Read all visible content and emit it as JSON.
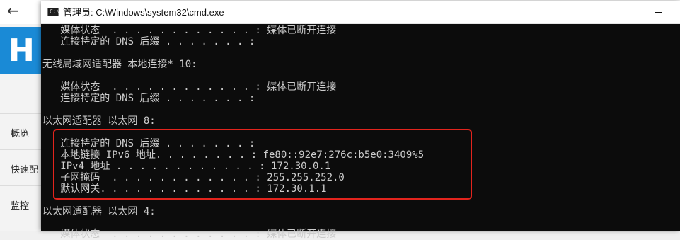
{
  "background_app": {
    "back_icon": "arrow-left-icon",
    "back_glyph": "←",
    "logo_text": "H",
    "nav": [
      {
        "label": "概览"
      },
      {
        "label": "快速配"
      },
      {
        "label": "监控"
      }
    ]
  },
  "window": {
    "title": "管理员: C:\\Windows\\system32\\cmd.exe",
    "icon": "cmd-icon",
    "icon_text": "C:\\"
  },
  "console": {
    "lines": [
      "   媒体状态  . . . . . . . . . . . . : 媒体已断开连接",
      "   连接特定的 DNS 后缀 . . . . . . . :",
      "",
      "无线局域网适配器 本地连接* 10:",
      "",
      "   媒体状态  . . . . . . . . . . . . : 媒体已断开连接",
      "   连接特定的 DNS 后缀 . . . . . . . :",
      "",
      "以太网适配器 以太网 8:",
      "",
      "   连接特定的 DNS 后缀 . . . . . . . :",
      "   本地链接 IPv6 地址. . . . . . . . : fe80::92e7:276c:b5e0:3409%5",
      "   IPv4 地址 . . . . . . . . . . . . : 172.30.0.1",
      "   子网掩码  . . . . . . . . . . . . : 255.255.252.0",
      "   默认网关. . . . . . . . . . . . . : 172.30.1.1",
      "",
      "以太网适配器 以太网 4:",
      "",
      "   媒体状态  . . . . . . . . . . . . : 媒体已断开连接"
    ]
  },
  "colors": {
    "console_bg": "#0c0c0c",
    "console_text": "#cccccc",
    "highlight": "#e2241d",
    "banner": "#1a8ad6"
  }
}
